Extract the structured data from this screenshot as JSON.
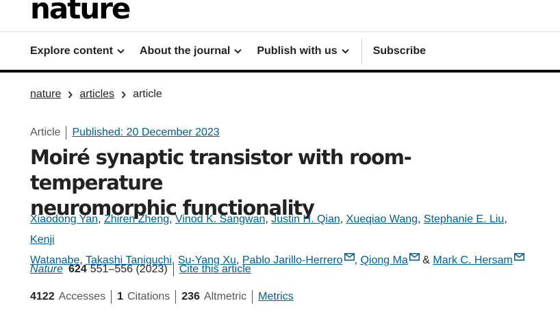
{
  "site": {
    "logo": "nature"
  },
  "nav": {
    "items": [
      {
        "label": "Explore content"
      },
      {
        "label": "About the journal"
      },
      {
        "label": "Publish with us"
      }
    ],
    "subscribe": "Subscribe"
  },
  "breadcrumb": [
    "nature",
    "articles",
    "article"
  ],
  "article": {
    "type": "Article",
    "published": "Published: 20 December 2023",
    "title_line1": "Moiré synaptic transistor with room-temperature",
    "title_line2": "neuromorphic functionality",
    "authors": [
      "Xiaodong Yan",
      "Zhiren Zheng",
      "Vinod K. Sangwan",
      "Justin H. Qian",
      "Xueqiao Wang",
      "Stephanie E. Liu",
      "Kenji Watanabe",
      "Takashi Taniguchi",
      "Su-Yang Xu",
      "Pablo Jarillo-Herrero",
      "Qiong Ma",
      "Mark C. Hersam"
    ],
    "author_kenji_part1": "Kenji",
    "author_kenji_part2": "Watanabe",
    "and": "&",
    "journal": "Nature",
    "volume": "624",
    "pages": "551–556 (2023)",
    "cite": "Cite this article"
  },
  "metrics": {
    "accesses_count": "4122",
    "accesses_label": "Accesses",
    "citations_count": "1",
    "citations_label": "Citations",
    "altmetric_count": "236",
    "altmetric_label": "Altmetric",
    "metrics_link": "Metrics"
  },
  "colors": {
    "link": "#025e8d",
    "text": "#222222",
    "rule": "#000000"
  },
  "icons": [
    "chevron-down-icon",
    "chevron-right-icon",
    "envelope-icon"
  ]
}
